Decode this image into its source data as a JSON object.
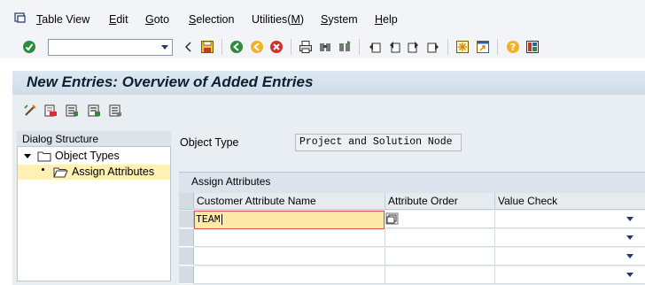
{
  "menu": {
    "items": [
      {
        "label": "Table View",
        "underline_index": 0
      },
      {
        "label": "Edit",
        "underline_index": 0
      },
      {
        "label": "Goto",
        "underline_index": 0
      },
      {
        "label": "Selection",
        "underline_index": 0
      },
      {
        "label": "Utilities(M)",
        "underline_index": 10
      },
      {
        "label": "System",
        "underline_index": 0
      },
      {
        "label": "Help",
        "underline_index": 0
      }
    ]
  },
  "toolbar": {
    "command_field_value": "",
    "icons": [
      "enter-icon",
      "save-icon",
      "back-icon",
      "exit-icon",
      "cancel-icon",
      "print-icon",
      "find-icon",
      "find-next-icon",
      "first-page-icon",
      "previous-page-icon",
      "next-page-icon",
      "last-page-icon",
      "create-session-icon",
      "shortcut-icon",
      "help-icon",
      "customize-layout-icon"
    ]
  },
  "page": {
    "title": "New Entries: Overview of Added Entries"
  },
  "app_toolbar": {
    "icons": [
      "change-display-icon",
      "delete-icon",
      "select-all-icon",
      "select-block-icon",
      "deselect-all-icon"
    ]
  },
  "dialog_structure": {
    "header": "Dialog Structure",
    "nodes": [
      {
        "label": "Object Types",
        "expanded": true
      },
      {
        "label": "Assign Attributes",
        "selected": true
      }
    ]
  },
  "object_type": {
    "label": "Object Type",
    "value": "Project and Solution Node"
  },
  "table": {
    "title": "Assign Attributes",
    "columns": [
      "Customer Attribute Name",
      "Attribute Order",
      "Value Check"
    ],
    "rows": [
      {
        "name": "TEAM",
        "order": "",
        "check": ""
      },
      {
        "name": "",
        "order": "",
        "check": ""
      },
      {
        "name": "",
        "order": "",
        "check": ""
      },
      {
        "name": "",
        "order": "",
        "check": ""
      }
    ]
  },
  "colors": {
    "title_band": "#d6e2ec",
    "content_bg": "#e9eef3",
    "selection_highlight": "#fff1b5",
    "input_highlight": "#ffe9a8",
    "input_border": "#e04c4c"
  }
}
